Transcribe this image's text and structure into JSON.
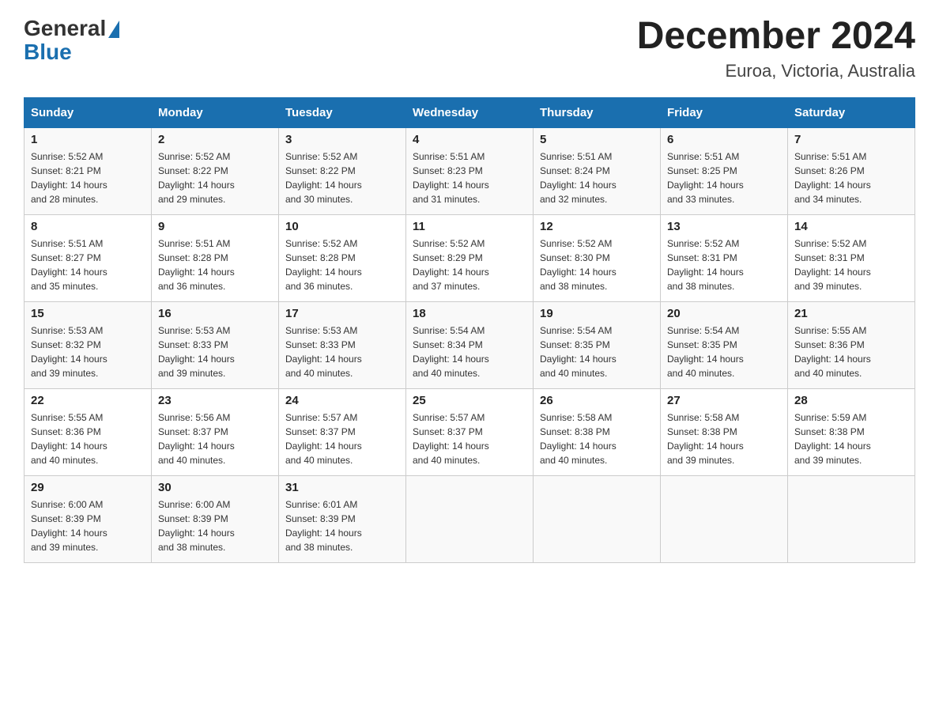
{
  "logo": {
    "general": "General",
    "blue": "Blue"
  },
  "header": {
    "title": "December 2024",
    "location": "Euroa, Victoria, Australia"
  },
  "days_of_week": [
    "Sunday",
    "Monday",
    "Tuesday",
    "Wednesday",
    "Thursday",
    "Friday",
    "Saturday"
  ],
  "weeks": [
    [
      {
        "day": "1",
        "sunrise": "5:52 AM",
        "sunset": "8:21 PM",
        "daylight": "14 hours and 28 minutes."
      },
      {
        "day": "2",
        "sunrise": "5:52 AM",
        "sunset": "8:22 PM",
        "daylight": "14 hours and 29 minutes."
      },
      {
        "day": "3",
        "sunrise": "5:52 AM",
        "sunset": "8:22 PM",
        "daylight": "14 hours and 30 minutes."
      },
      {
        "day": "4",
        "sunrise": "5:51 AM",
        "sunset": "8:23 PM",
        "daylight": "14 hours and 31 minutes."
      },
      {
        "day": "5",
        "sunrise": "5:51 AM",
        "sunset": "8:24 PM",
        "daylight": "14 hours and 32 minutes."
      },
      {
        "day": "6",
        "sunrise": "5:51 AM",
        "sunset": "8:25 PM",
        "daylight": "14 hours and 33 minutes."
      },
      {
        "day": "7",
        "sunrise": "5:51 AM",
        "sunset": "8:26 PM",
        "daylight": "14 hours and 34 minutes."
      }
    ],
    [
      {
        "day": "8",
        "sunrise": "5:51 AM",
        "sunset": "8:27 PM",
        "daylight": "14 hours and 35 minutes."
      },
      {
        "day": "9",
        "sunrise": "5:51 AM",
        "sunset": "8:28 PM",
        "daylight": "14 hours and 36 minutes."
      },
      {
        "day": "10",
        "sunrise": "5:52 AM",
        "sunset": "8:28 PM",
        "daylight": "14 hours and 36 minutes."
      },
      {
        "day": "11",
        "sunrise": "5:52 AM",
        "sunset": "8:29 PM",
        "daylight": "14 hours and 37 minutes."
      },
      {
        "day": "12",
        "sunrise": "5:52 AM",
        "sunset": "8:30 PM",
        "daylight": "14 hours and 38 minutes."
      },
      {
        "day": "13",
        "sunrise": "5:52 AM",
        "sunset": "8:31 PM",
        "daylight": "14 hours and 38 minutes."
      },
      {
        "day": "14",
        "sunrise": "5:52 AM",
        "sunset": "8:31 PM",
        "daylight": "14 hours and 39 minutes."
      }
    ],
    [
      {
        "day": "15",
        "sunrise": "5:53 AM",
        "sunset": "8:32 PM",
        "daylight": "14 hours and 39 minutes."
      },
      {
        "day": "16",
        "sunrise": "5:53 AM",
        "sunset": "8:33 PM",
        "daylight": "14 hours and 39 minutes."
      },
      {
        "day": "17",
        "sunrise": "5:53 AM",
        "sunset": "8:33 PM",
        "daylight": "14 hours and 40 minutes."
      },
      {
        "day": "18",
        "sunrise": "5:54 AM",
        "sunset": "8:34 PM",
        "daylight": "14 hours and 40 minutes."
      },
      {
        "day": "19",
        "sunrise": "5:54 AM",
        "sunset": "8:35 PM",
        "daylight": "14 hours and 40 minutes."
      },
      {
        "day": "20",
        "sunrise": "5:54 AM",
        "sunset": "8:35 PM",
        "daylight": "14 hours and 40 minutes."
      },
      {
        "day": "21",
        "sunrise": "5:55 AM",
        "sunset": "8:36 PM",
        "daylight": "14 hours and 40 minutes."
      }
    ],
    [
      {
        "day": "22",
        "sunrise": "5:55 AM",
        "sunset": "8:36 PM",
        "daylight": "14 hours and 40 minutes."
      },
      {
        "day": "23",
        "sunrise": "5:56 AM",
        "sunset": "8:37 PM",
        "daylight": "14 hours and 40 minutes."
      },
      {
        "day": "24",
        "sunrise": "5:57 AM",
        "sunset": "8:37 PM",
        "daylight": "14 hours and 40 minutes."
      },
      {
        "day": "25",
        "sunrise": "5:57 AM",
        "sunset": "8:37 PM",
        "daylight": "14 hours and 40 minutes."
      },
      {
        "day": "26",
        "sunrise": "5:58 AM",
        "sunset": "8:38 PM",
        "daylight": "14 hours and 40 minutes."
      },
      {
        "day": "27",
        "sunrise": "5:58 AM",
        "sunset": "8:38 PM",
        "daylight": "14 hours and 39 minutes."
      },
      {
        "day": "28",
        "sunrise": "5:59 AM",
        "sunset": "8:38 PM",
        "daylight": "14 hours and 39 minutes."
      }
    ],
    [
      {
        "day": "29",
        "sunrise": "6:00 AM",
        "sunset": "8:39 PM",
        "daylight": "14 hours and 39 minutes."
      },
      {
        "day": "30",
        "sunrise": "6:00 AM",
        "sunset": "8:39 PM",
        "daylight": "14 hours and 38 minutes."
      },
      {
        "day": "31",
        "sunrise": "6:01 AM",
        "sunset": "8:39 PM",
        "daylight": "14 hours and 38 minutes."
      },
      null,
      null,
      null,
      null
    ]
  ],
  "labels": {
    "sunrise": "Sunrise:",
    "sunset": "Sunset:",
    "daylight": "Daylight:"
  }
}
